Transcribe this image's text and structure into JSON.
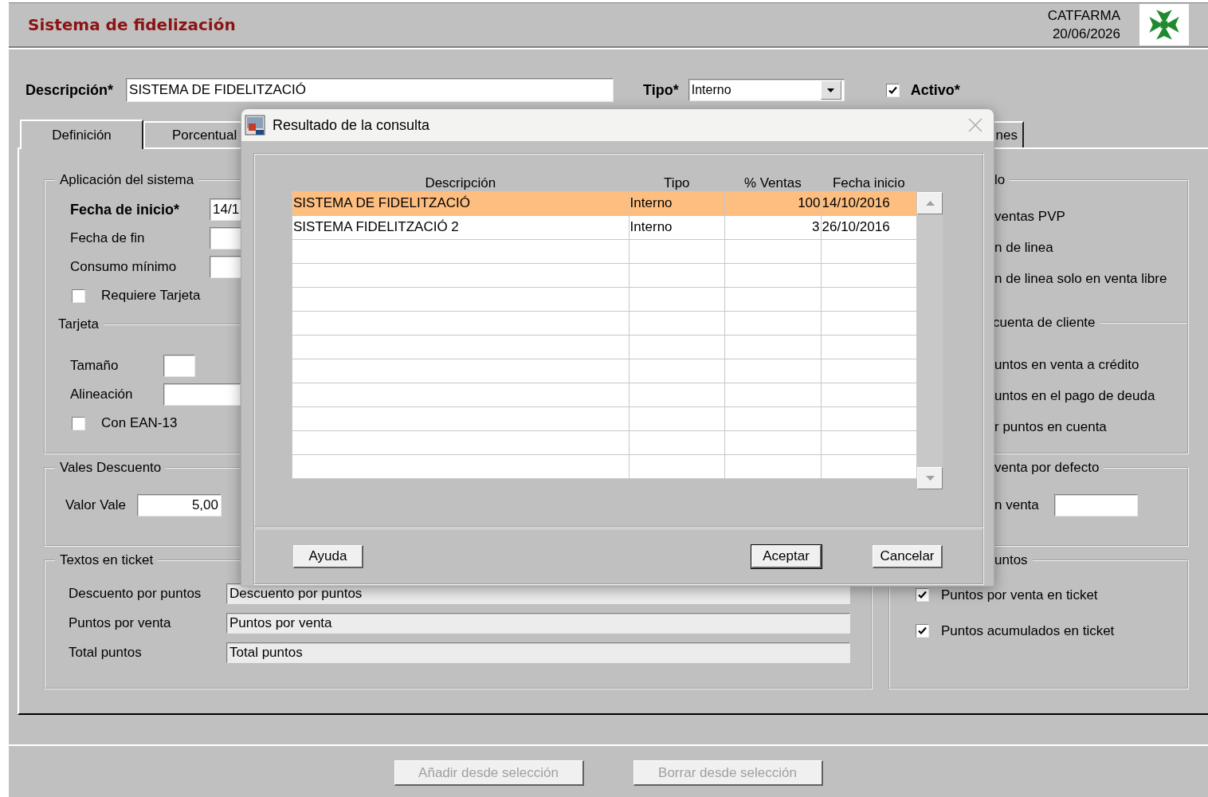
{
  "header": {
    "title": "Sistema de fidelización",
    "company": "CATFARMA",
    "date": "20/06/2026"
  },
  "form": {
    "description": {
      "label": "Descripción*",
      "value": "SISTEMA DE FIDELITZACIÓ"
    },
    "type": {
      "label": "Tipo*",
      "value": "Interno"
    },
    "active": {
      "label": "Activo*",
      "checked": true
    }
  },
  "tabs": [
    {
      "label": "Definición",
      "selected": true
    },
    {
      "label": "Porcentual",
      "selected": false
    },
    {
      "label": "nes",
      "selected": false
    }
  ],
  "left_groups": [
    {
      "title": "Aplicación del sistema",
      "rows": [
        {
          "kind": "field",
          "label": "Fecha de inicio*",
          "required": true,
          "value": "14/1"
        },
        {
          "kind": "field",
          "label": "Fecha de fin",
          "required": false
        },
        {
          "kind": "field",
          "label": "Consumo mínimo",
          "required": false
        },
        {
          "kind": "checkbox",
          "label": "Requiere Tarjeta",
          "checked": false
        },
        {
          "kind": "subheading",
          "label": "Tarjeta"
        },
        {
          "kind": "field",
          "label": "Tamaño",
          "required": false
        },
        {
          "kind": "field",
          "label": "Alineación",
          "required": false
        },
        {
          "kind": "checkbox",
          "label": "Con EAN-13",
          "checked": false
        }
      ]
    },
    {
      "title": "Vales Descuento",
      "rows": [
        {
          "kind": "amount",
          "label": "Valor Vale",
          "required": false,
          "value": "5,00"
        }
      ]
    },
    {
      "title": "Textos en ticket",
      "rows": [
        {
          "kind": "field",
          "label": "Descuento por puntos",
          "required": false,
          "value": "Descuento por puntos"
        },
        {
          "kind": "field",
          "label": "Puntos por venta",
          "required": false,
          "value": "Puntos por venta"
        },
        {
          "kind": "field",
          "label": "Total puntos",
          "required": false,
          "value": "Total puntos"
        }
      ]
    }
  ],
  "right_groups": [
    {
      "title": "lo",
      "rows": [
        {
          "kind": "text",
          "label": "ventas PVP"
        },
        {
          "kind": "text",
          "label": "n de linea"
        },
        {
          "kind": "text",
          "label": "n de linea solo en venta libre"
        },
        {
          "kind": "subheading",
          "label": "cuenta de cliente"
        },
        {
          "kind": "text",
          "label": "untos en venta a crédito"
        },
        {
          "kind": "text",
          "label": "untos en el pago de deuda"
        },
        {
          "kind": "text",
          "label": "r puntos en cuenta"
        }
      ]
    },
    {
      "title": "venta por defecto",
      "rows": [
        {
          "kind": "field",
          "label": "n venta",
          "required": false
        }
      ]
    },
    {
      "title": "untos",
      "rows": [
        {
          "kind": "checkbox",
          "label": "Puntos por venta en ticket",
          "checked": true
        },
        {
          "kind": "checkbox",
          "label": "Puntos acumulados en ticket",
          "checked": true
        }
      ]
    }
  ],
  "dialog": {
    "title": "Resultado de la consulta",
    "columns": [
      "Descripción",
      "Tipo",
      "% Ventas",
      "Fecha inicio"
    ],
    "rows": [
      {
        "cells": [
          "SISTEMA DE FIDELITZACIÓ",
          "Interno",
          "100",
          "14/10/2016"
        ],
        "selected": true
      },
      {
        "cells": [
          "SISTEMA FIDELITZACIÓ 2",
          "Interno",
          "3",
          "26/10/2016"
        ],
        "selected": false
      }
    ],
    "buttons": [
      {
        "label": "Ayuda",
        "default": false
      },
      {
        "label": "Aceptar",
        "default": true
      },
      {
        "label": "Cancelar",
        "default": false
      }
    ]
  },
  "footer_buttons": [
    {
      "label": "Añadir desde selección",
      "disabled": true
    },
    {
      "label": "Borrar desde selección",
      "disabled": true
    }
  ]
}
